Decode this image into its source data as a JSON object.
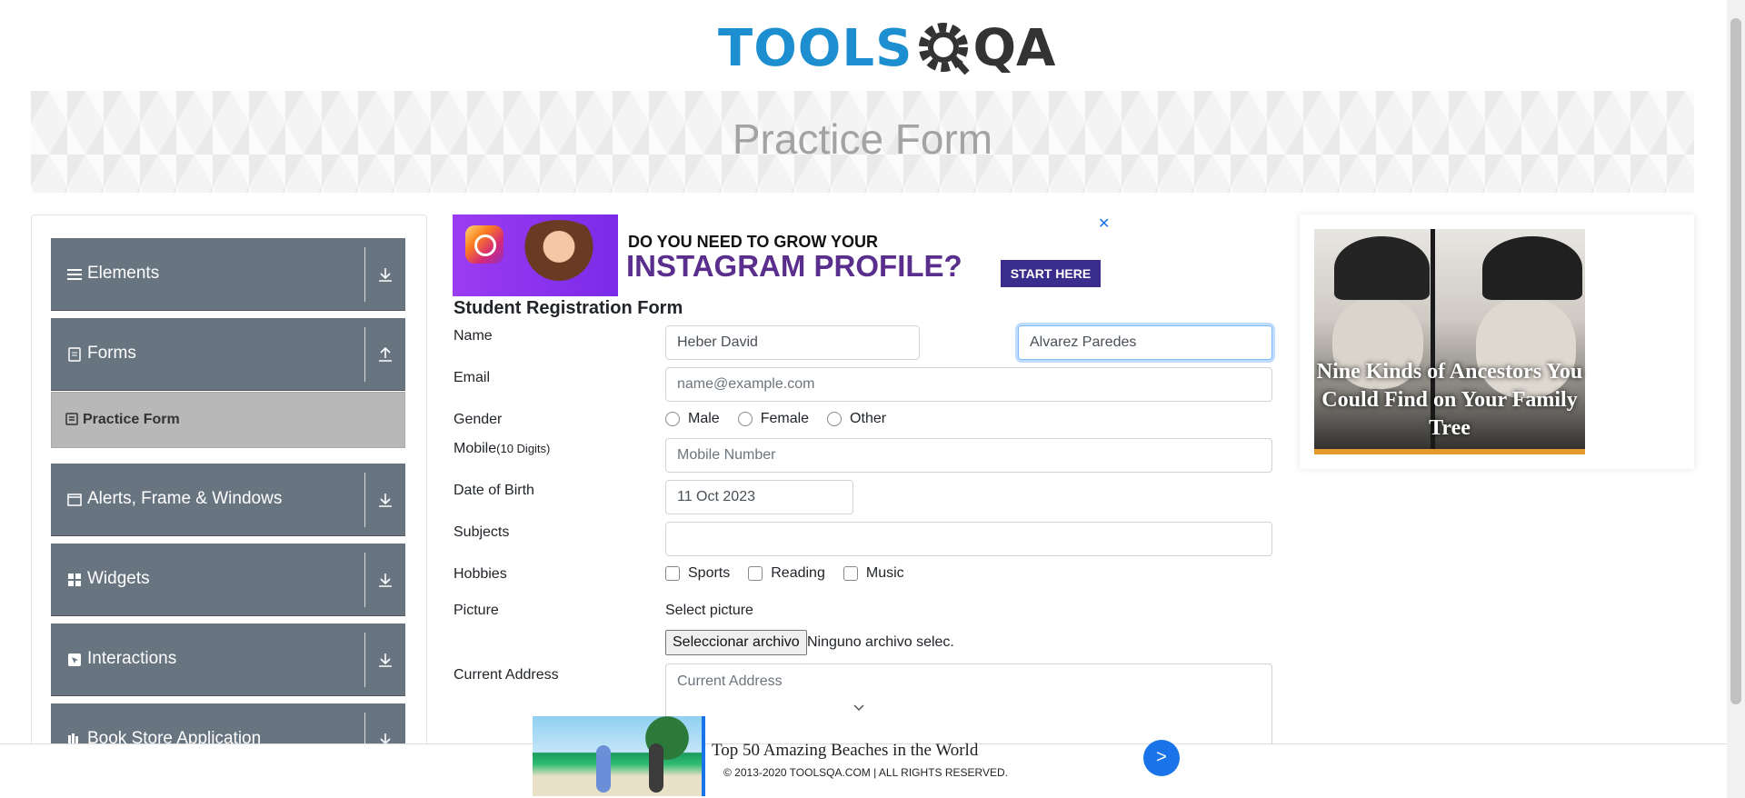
{
  "brand": {
    "logo_tools": "TOOLS",
    "logo_qa": "QA"
  },
  "banner": {
    "title": "Practice Form"
  },
  "sidebar": {
    "groups": [
      {
        "label": "Elements",
        "icon": "list-icon"
      },
      {
        "label": "Forms",
        "icon": "file-icon"
      },
      {
        "label": "Alerts, Frame & Windows",
        "icon": "window-icon"
      },
      {
        "label": "Widgets",
        "icon": "grid-icon"
      },
      {
        "label": "Interactions",
        "icon": "cursor-icon"
      },
      {
        "label": "Book Store Application",
        "icon": "book-icon"
      }
    ],
    "active_item": "Practice Form"
  },
  "ad_top": {
    "line1": "DO YOU NEED TO GROW YOUR",
    "line2": "INSTAGRAM PROFILE?",
    "cta": "START HERE",
    "close": "✕"
  },
  "form": {
    "title": "Student Registration Form",
    "name_label": "Name",
    "first_name": "Heber David",
    "last_name": "Alvarez Paredes",
    "email_label": "Email",
    "email_placeholder": "name@example.com",
    "gender_label": "Gender",
    "gender_options": [
      "Male",
      "Female",
      "Other"
    ],
    "mobile_label": "Mobile",
    "mobile_hint": "(10 Digits)",
    "mobile_placeholder": "Mobile Number",
    "dob_label": "Date of Birth",
    "dob_value": "11 Oct 2023",
    "subjects_label": "Subjects",
    "hobbies_label": "Hobbies",
    "hobby_options": [
      "Sports",
      "Reading",
      "Music"
    ],
    "picture_label": "Picture",
    "select_picture": "Select picture",
    "file_button": "Seleccionar archivo",
    "file_status": "Ninguno archivo selec.",
    "address_label": "Current Address",
    "address_placeholder": "Current Address"
  },
  "ad_right": {
    "caption": "Nine Kinds of Ancestors You Could Find on Your Family Tree"
  },
  "ad_bottom": {
    "title": "Top 50 Amazing Beaches in the World",
    "go": ">"
  },
  "footer": {
    "text": "© 2013-2020 TOOLSQA.COM | ALL RIGHTS RESERVED."
  }
}
